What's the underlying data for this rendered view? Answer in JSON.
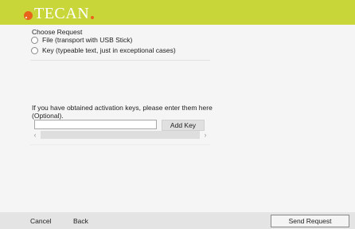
{
  "header": {
    "logo_text": "TECAN",
    "brand_color": "#c8d63a",
    "accent_color": "#e8641c"
  },
  "request": {
    "section_title": "Choose Request",
    "options": [
      {
        "label": "File (transport with USB Stick)",
        "selected": false
      },
      {
        "label": "Key (typeable text, just in exceptional cases)",
        "selected": false
      }
    ]
  },
  "activation": {
    "info_text": "If you have obtained activation keys, please enter them here (Optional).",
    "key_input_value": "",
    "add_key_label": "Add Key",
    "scroll_left": "‹",
    "scroll_right": "›"
  },
  "footer": {
    "cancel_label": "Cancel",
    "back_label": "Back",
    "send_label": "Send Request"
  }
}
